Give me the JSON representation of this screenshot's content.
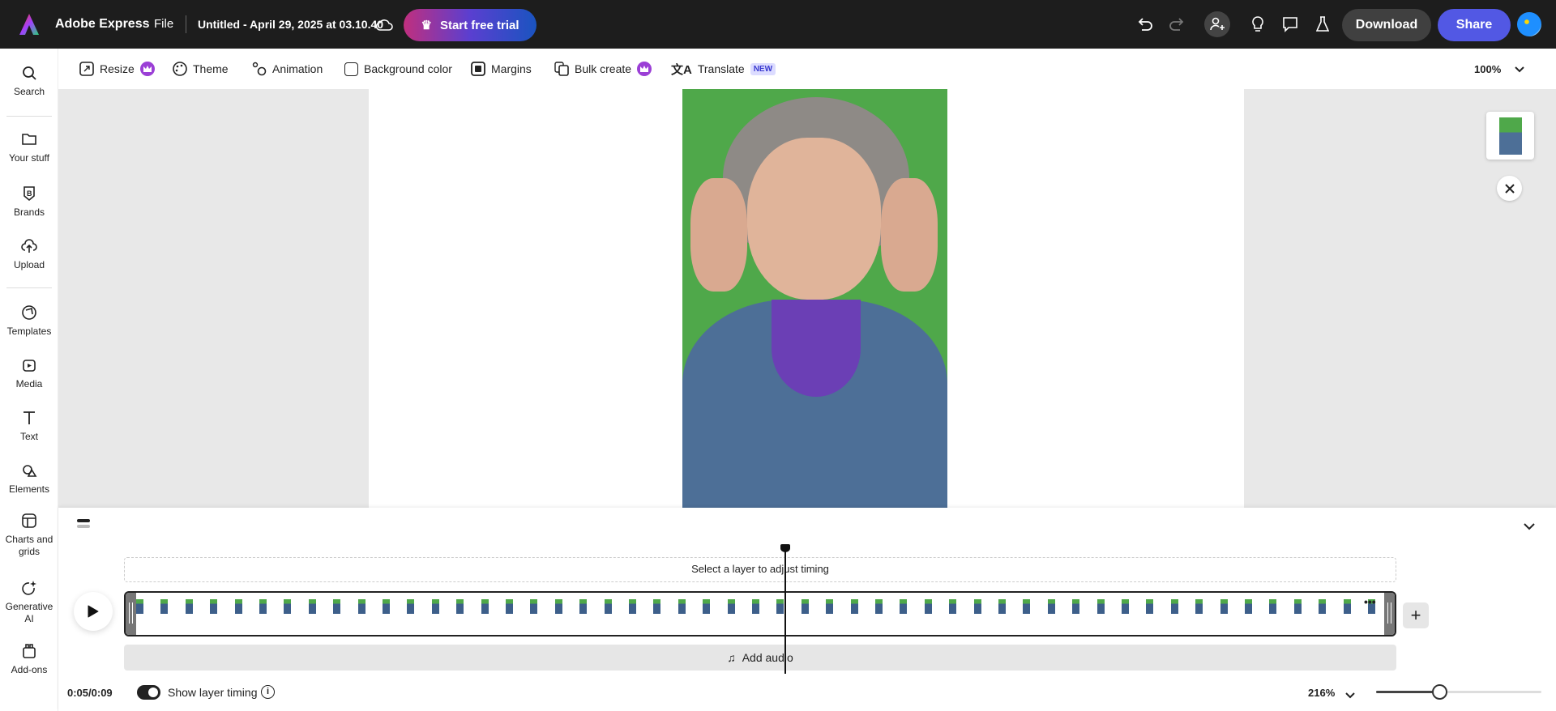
{
  "header": {
    "app_name": "Adobe Express",
    "file_menu": "File",
    "doc_title": "Untitled - April 29, 2025 at 03.10.40",
    "trial_button": "Start free trial",
    "download_button": "Download",
    "share_button": "Share"
  },
  "toolbar": {
    "items": [
      {
        "label": "Resize",
        "premium": true
      },
      {
        "label": "Theme"
      },
      {
        "label": "Animation"
      },
      {
        "label": "Background color"
      },
      {
        "label": "Margins"
      },
      {
        "label": "Bulk create",
        "premium": true
      },
      {
        "label": "Translate",
        "badge": "NEW"
      }
    ],
    "zoom": "100%"
  },
  "sidebar": {
    "items": [
      {
        "label": "Search"
      },
      {
        "label": "Your stuff"
      },
      {
        "label": "Brands"
      },
      {
        "label": "Upload"
      },
      {
        "label": "Templates"
      },
      {
        "label": "Media"
      },
      {
        "label": "Text"
      },
      {
        "label": "Elements"
      },
      {
        "label": "Charts and grids"
      },
      {
        "label": "Generative AI"
      },
      {
        "label": "Add-ons"
      }
    ]
  },
  "timeline": {
    "hint": "Select a layer to adjust timing",
    "add_audio": "Add audio",
    "time": "0:05/0:09",
    "show_layer_timing": "Show layer timing",
    "show_layer_timing_on": true,
    "zoom": "216%",
    "zoom_slider_fraction": 0.38,
    "playhead_fraction": 0.52,
    "frame_count": 51
  },
  "colors": {
    "topbar": "#1d1d1d",
    "share": "#5258e4",
    "trial_from": "#c02f7e",
    "trial_to": "#1a54c0"
  }
}
